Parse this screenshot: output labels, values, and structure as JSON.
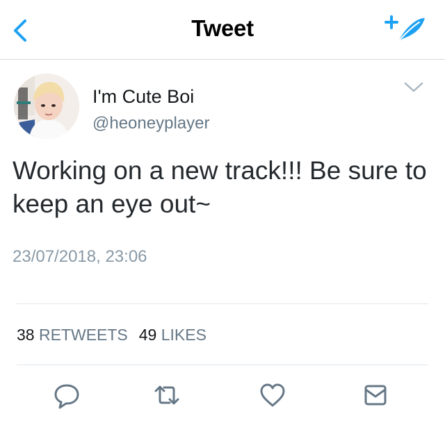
{
  "nav": {
    "title": "Tweet",
    "back_icon": "chevron-left-icon",
    "compose_icon": "compose-feather-icon",
    "accent_color": "#1da1f2"
  },
  "tweet": {
    "author": {
      "display_name": "I'm Cute Boi",
      "handle": "@heoneyplayer"
    },
    "text": "Working on a new track!!! Be sure to keep an eye out~",
    "timestamp": "23/07/2018, 23:06",
    "stats": {
      "retweets_count": "38",
      "retweets_label": "RETWEETS",
      "likes_count": "49",
      "likes_label": "LIKES"
    },
    "actions": [
      "reply-icon",
      "retweet-icon",
      "like-icon",
      "direct-message-icon"
    ]
  }
}
